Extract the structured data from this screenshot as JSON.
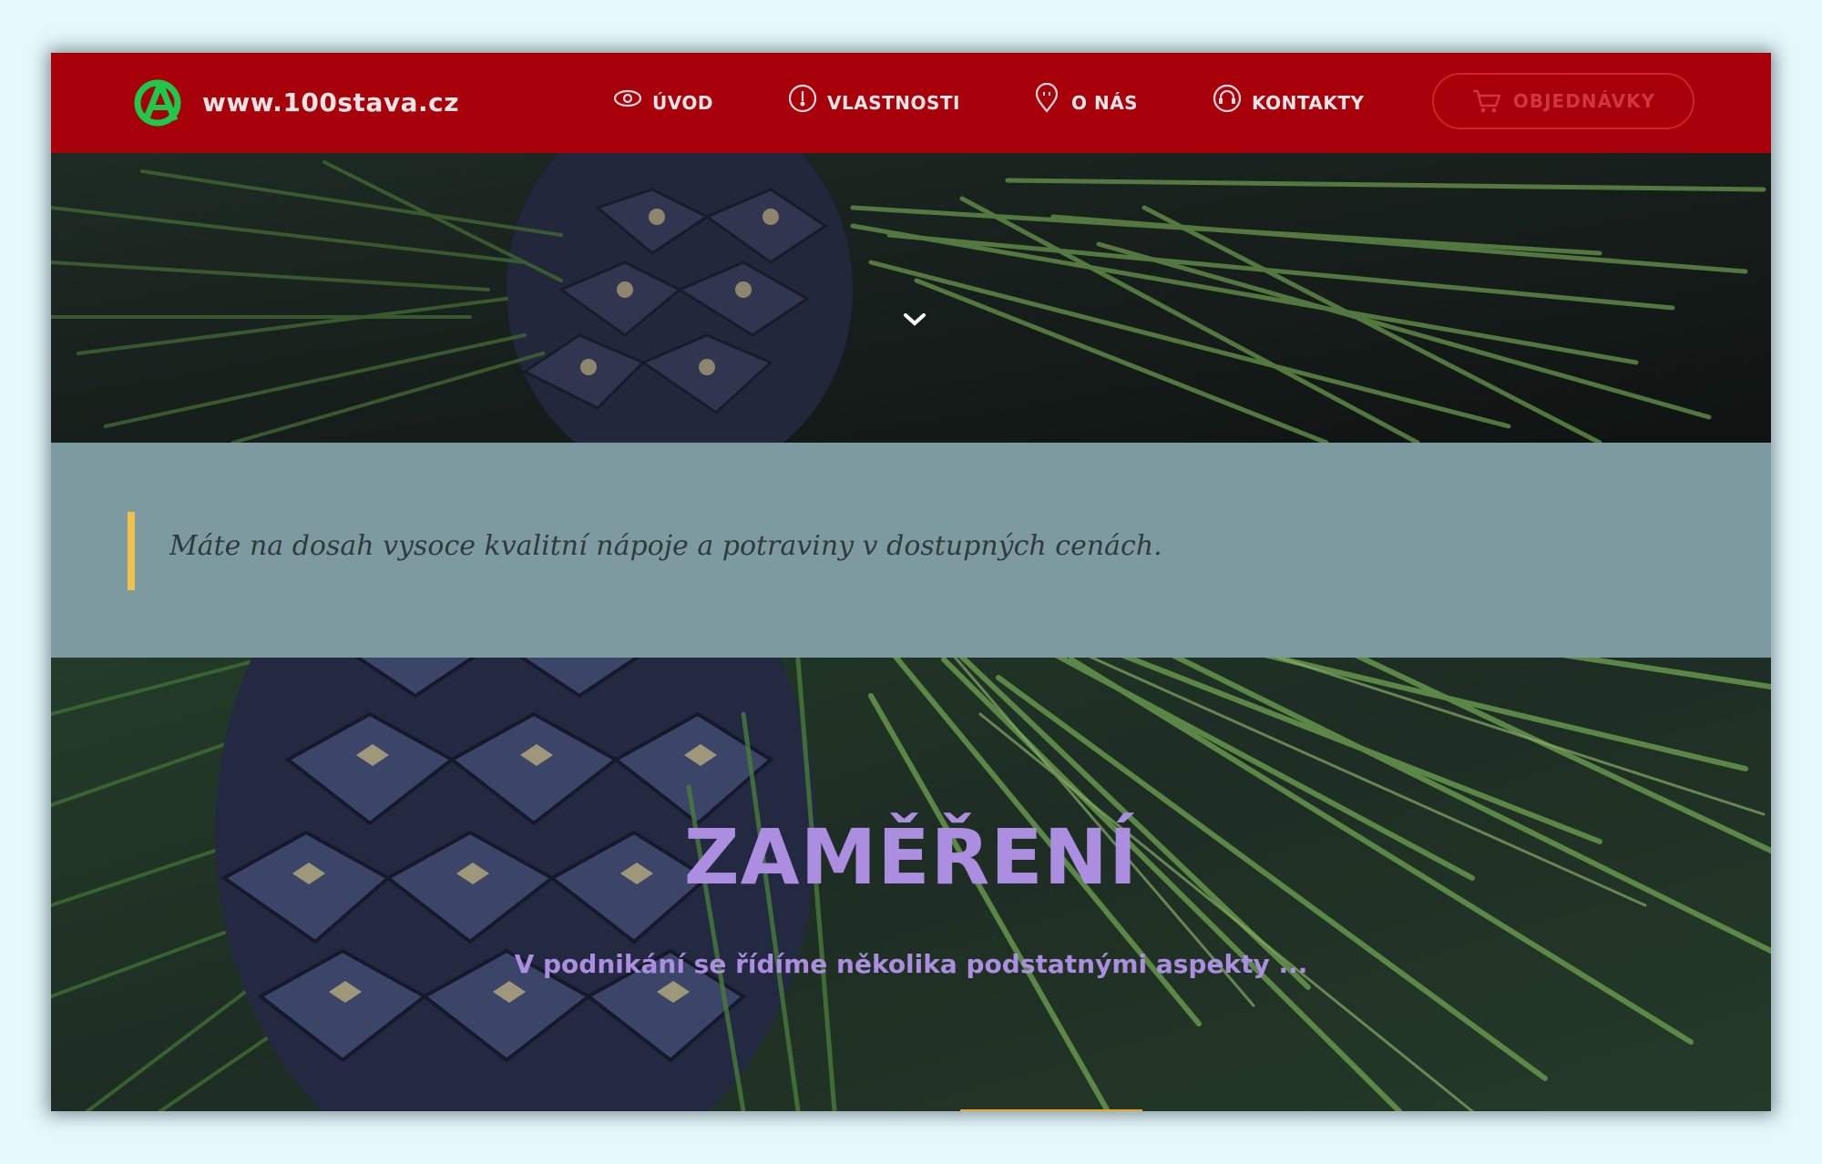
{
  "header": {
    "site_name": "www.100stava.cz",
    "nav": [
      {
        "label": "ÚVOD",
        "icon": "eye-icon"
      },
      {
        "label": "VLASTNOSTI",
        "icon": "thermometer-icon"
      },
      {
        "label": "O NÁS",
        "icon": "location-pin-icon"
      },
      {
        "label": "KONTAKTY",
        "icon": "headset-icon"
      }
    ],
    "order_button": {
      "label": "OBJEDNÁVKY",
      "icon": "cart-icon"
    }
  },
  "quote": {
    "text": "Máte na dosah vysoce kvalitní nápoje a potraviny v dostupných cenách."
  },
  "hero": {
    "title": "ZAMĚŘENÍ",
    "subtitle": "V podnikání se řídíme několika podstatnými aspekty ..."
  },
  "colors": {
    "header_bg": "#a8000b",
    "logo_green": "#1fc84a",
    "quote_band": "#7d9aa0",
    "quote_bar": "#f1c24b",
    "hero_text": "#ab8ee0"
  }
}
